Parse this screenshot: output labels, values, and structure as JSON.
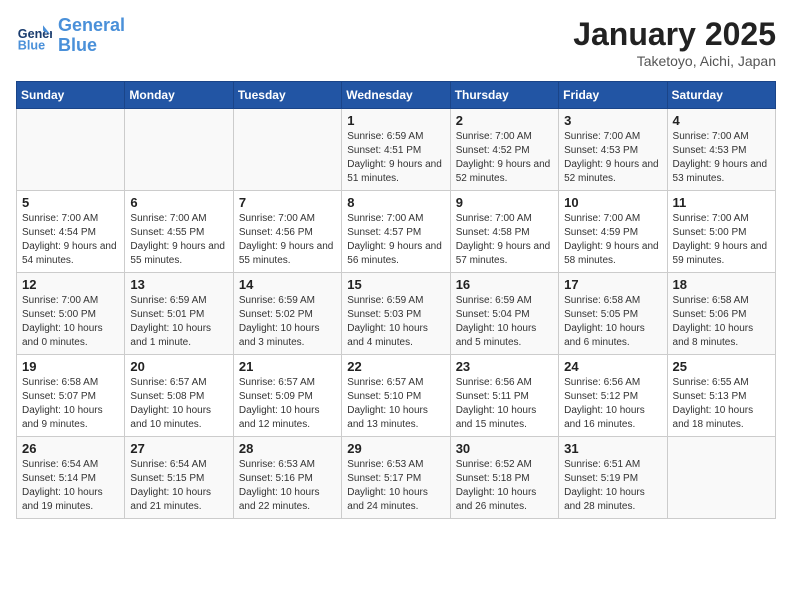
{
  "header": {
    "logo_line1": "General",
    "logo_line2": "Blue",
    "title": "January 2025",
    "location": "Taketoyo, Aichi, Japan"
  },
  "days_of_week": [
    "Sunday",
    "Monday",
    "Tuesday",
    "Wednesday",
    "Thursday",
    "Friday",
    "Saturday"
  ],
  "weeks": [
    [
      {
        "day": "",
        "info": ""
      },
      {
        "day": "",
        "info": ""
      },
      {
        "day": "",
        "info": ""
      },
      {
        "day": "1",
        "info": "Sunrise: 6:59 AM\nSunset: 4:51 PM\nDaylight: 9 hours and 51 minutes."
      },
      {
        "day": "2",
        "info": "Sunrise: 7:00 AM\nSunset: 4:52 PM\nDaylight: 9 hours and 52 minutes."
      },
      {
        "day": "3",
        "info": "Sunrise: 7:00 AM\nSunset: 4:53 PM\nDaylight: 9 hours and 52 minutes."
      },
      {
        "day": "4",
        "info": "Sunrise: 7:00 AM\nSunset: 4:53 PM\nDaylight: 9 hours and 53 minutes."
      }
    ],
    [
      {
        "day": "5",
        "info": "Sunrise: 7:00 AM\nSunset: 4:54 PM\nDaylight: 9 hours and 54 minutes."
      },
      {
        "day": "6",
        "info": "Sunrise: 7:00 AM\nSunset: 4:55 PM\nDaylight: 9 hours and 55 minutes."
      },
      {
        "day": "7",
        "info": "Sunrise: 7:00 AM\nSunset: 4:56 PM\nDaylight: 9 hours and 55 minutes."
      },
      {
        "day": "8",
        "info": "Sunrise: 7:00 AM\nSunset: 4:57 PM\nDaylight: 9 hours and 56 minutes."
      },
      {
        "day": "9",
        "info": "Sunrise: 7:00 AM\nSunset: 4:58 PM\nDaylight: 9 hours and 57 minutes."
      },
      {
        "day": "10",
        "info": "Sunrise: 7:00 AM\nSunset: 4:59 PM\nDaylight: 9 hours and 58 minutes."
      },
      {
        "day": "11",
        "info": "Sunrise: 7:00 AM\nSunset: 5:00 PM\nDaylight: 9 hours and 59 minutes."
      }
    ],
    [
      {
        "day": "12",
        "info": "Sunrise: 7:00 AM\nSunset: 5:00 PM\nDaylight: 10 hours and 0 minutes."
      },
      {
        "day": "13",
        "info": "Sunrise: 6:59 AM\nSunset: 5:01 PM\nDaylight: 10 hours and 1 minute."
      },
      {
        "day": "14",
        "info": "Sunrise: 6:59 AM\nSunset: 5:02 PM\nDaylight: 10 hours and 3 minutes."
      },
      {
        "day": "15",
        "info": "Sunrise: 6:59 AM\nSunset: 5:03 PM\nDaylight: 10 hours and 4 minutes."
      },
      {
        "day": "16",
        "info": "Sunrise: 6:59 AM\nSunset: 5:04 PM\nDaylight: 10 hours and 5 minutes."
      },
      {
        "day": "17",
        "info": "Sunrise: 6:58 AM\nSunset: 5:05 PM\nDaylight: 10 hours and 6 minutes."
      },
      {
        "day": "18",
        "info": "Sunrise: 6:58 AM\nSunset: 5:06 PM\nDaylight: 10 hours and 8 minutes."
      }
    ],
    [
      {
        "day": "19",
        "info": "Sunrise: 6:58 AM\nSunset: 5:07 PM\nDaylight: 10 hours and 9 minutes."
      },
      {
        "day": "20",
        "info": "Sunrise: 6:57 AM\nSunset: 5:08 PM\nDaylight: 10 hours and 10 minutes."
      },
      {
        "day": "21",
        "info": "Sunrise: 6:57 AM\nSunset: 5:09 PM\nDaylight: 10 hours and 12 minutes."
      },
      {
        "day": "22",
        "info": "Sunrise: 6:57 AM\nSunset: 5:10 PM\nDaylight: 10 hours and 13 minutes."
      },
      {
        "day": "23",
        "info": "Sunrise: 6:56 AM\nSunset: 5:11 PM\nDaylight: 10 hours and 15 minutes."
      },
      {
        "day": "24",
        "info": "Sunrise: 6:56 AM\nSunset: 5:12 PM\nDaylight: 10 hours and 16 minutes."
      },
      {
        "day": "25",
        "info": "Sunrise: 6:55 AM\nSunset: 5:13 PM\nDaylight: 10 hours and 18 minutes."
      }
    ],
    [
      {
        "day": "26",
        "info": "Sunrise: 6:54 AM\nSunset: 5:14 PM\nDaylight: 10 hours and 19 minutes."
      },
      {
        "day": "27",
        "info": "Sunrise: 6:54 AM\nSunset: 5:15 PM\nDaylight: 10 hours and 21 minutes."
      },
      {
        "day": "28",
        "info": "Sunrise: 6:53 AM\nSunset: 5:16 PM\nDaylight: 10 hours and 22 minutes."
      },
      {
        "day": "29",
        "info": "Sunrise: 6:53 AM\nSunset: 5:17 PM\nDaylight: 10 hours and 24 minutes."
      },
      {
        "day": "30",
        "info": "Sunrise: 6:52 AM\nSunset: 5:18 PM\nDaylight: 10 hours and 26 minutes."
      },
      {
        "day": "31",
        "info": "Sunrise: 6:51 AM\nSunset: 5:19 PM\nDaylight: 10 hours and 28 minutes."
      },
      {
        "day": "",
        "info": ""
      }
    ]
  ]
}
